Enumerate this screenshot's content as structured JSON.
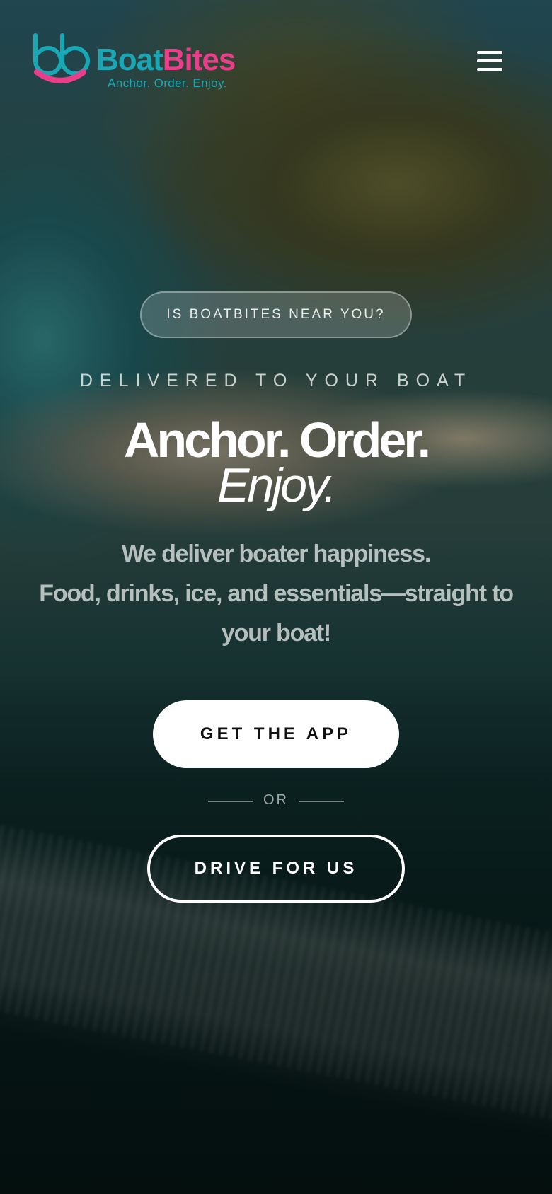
{
  "header": {
    "brand_part1": "Boat",
    "brand_part2": "Bites",
    "tagline": "Anchor. Order. Enjoy.",
    "menu_icon": "hamburger-menu-icon"
  },
  "hero": {
    "location_button": "IS BOATBITES NEAR YOU?",
    "eyebrow": "DELIVERED TO YOUR BOAT",
    "headline_line1": "Anchor. Order.",
    "headline_line2": "Enjoy.",
    "subtext_line1": "We deliver boater happiness.",
    "subtext_line2": "Food, drinks, ice, and essentials—straight to your boat!",
    "primary_cta": "GET THE APP",
    "divider_text": "OR",
    "secondary_cta": "DRIVE FOR US"
  },
  "colors": {
    "brand_teal": "#19a7b6",
    "brand_pink": "#ea3d8a",
    "primary_button_bg": "#ffffff",
    "primary_button_text": "#111111"
  }
}
